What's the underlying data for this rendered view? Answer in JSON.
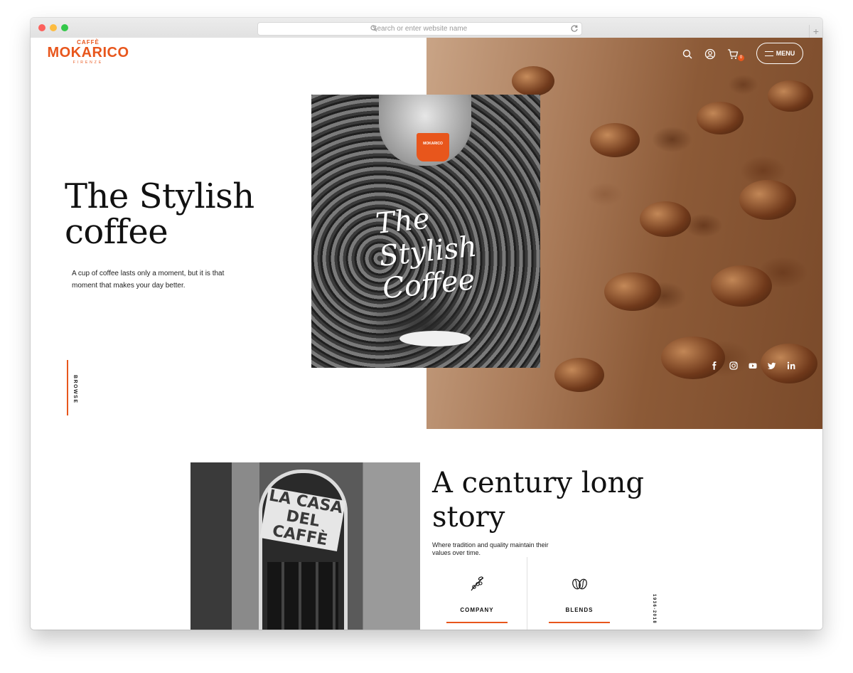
{
  "browser": {
    "address_placeholder": "Search or enter website name",
    "new_tab_label": "+"
  },
  "header": {
    "logo_top": "CAFFÈ",
    "logo_brand": "MOKARICO",
    "logo_city": "FIRENZE",
    "cart_count": "0",
    "menu_label": "MENU"
  },
  "hero": {
    "title": "The Stylish coffee",
    "subtitle": "A cup of coffee lasts only a moment, but it is that moment that makes your day better.",
    "browse_label": "BROWSE",
    "photo_script": "The Stylish Coffee",
    "cup_label": "MOKARICO"
  },
  "social": [
    "facebook-icon",
    "instagram-icon",
    "youtube-icon",
    "twitter-icon",
    "linkedin-icon"
  ],
  "story": {
    "title": "A century long story",
    "subtitle": "Where tradition and quality maintain their values over time.",
    "shop_sign": "LA CASA DEL CAFFÈ",
    "cards": [
      {
        "label": "COMPANY",
        "icon": "coffee-plant-icon"
      },
      {
        "label": "BLENDS",
        "icon": "coffee-beans-icon"
      }
    ],
    "years": "1936-2018"
  },
  "colors": {
    "accent": "#e8561c"
  }
}
